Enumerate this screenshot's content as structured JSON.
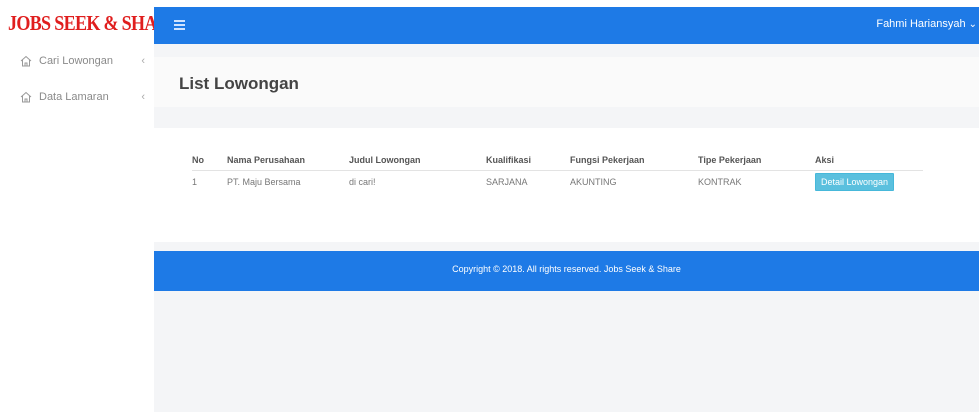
{
  "brand": {
    "name": "JOBS SEEK & SHARE"
  },
  "sidebar": {
    "items": [
      {
        "label": "Cari Lowongan",
        "icon": "home-icon"
      },
      {
        "label": "Data Lamaran",
        "icon": "home-icon"
      }
    ]
  },
  "header": {
    "user_name": "Fahmi Hariansyah",
    "colors": {
      "bar": "#1e7ae6"
    }
  },
  "page": {
    "title": "List Lowongan"
  },
  "table": {
    "headers": [
      "No",
      "Nama Perusahaan",
      "Judul Lowongan",
      "Kualifikasi",
      "Fungsi Pekerjaan",
      "Tipe Pekerjaan",
      "Aksi"
    ],
    "rows": [
      {
        "no": "1",
        "perusahaan": "PT. Maju Bersama",
        "judul": "di cari!",
        "kualifikasi": "SARJANA",
        "fungsi": "AKUNTING",
        "tipe": "KONTRAK",
        "aksi": "Detail Lowongan"
      }
    ]
  },
  "footer": {
    "text": "Copyright © 2018. All rights reserved. Jobs Seek & Share"
  }
}
